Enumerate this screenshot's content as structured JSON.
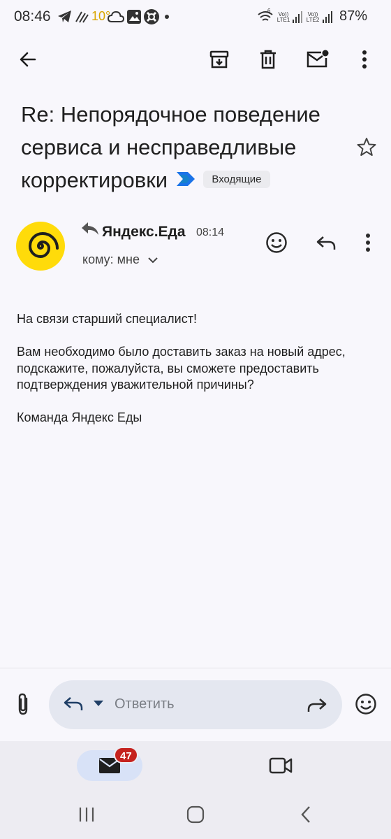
{
  "status_bar": {
    "time": "08:46",
    "temperature": "10°",
    "signal_1_label": "Vo)) LTE1",
    "signal_2_label": "Vo)) LTE2",
    "wifi_label": "6",
    "battery": "87%"
  },
  "toolbar": {
    "back_icon": "arrow-left",
    "archive_icon": "archive",
    "delete_icon": "trash",
    "mark_unread_icon": "mail-unread",
    "more_icon": "more-vert"
  },
  "subject": {
    "text": "Re: Непорядочное поведение сервиса и несправедливые корректировки",
    "label": "Входящие",
    "importance_color": "#1a73e8"
  },
  "sender": {
    "name": "Яндекс.Еда",
    "time": "08:14",
    "recipient": "кому: мне",
    "avatar_color": "#ffdb0a"
  },
  "message": {
    "lines": [
      "На связи старший специалист!",
      "Вам необходимо было доставить заказ на новый адрес, подскажите, пожалуйста, вы сможете предоставить подтверждения уважительной причины?",
      "Команда Яндекс Еды"
    ]
  },
  "reply_bar": {
    "placeholder": "Ответить"
  },
  "bottom_nav": {
    "mail_badge": "47"
  }
}
